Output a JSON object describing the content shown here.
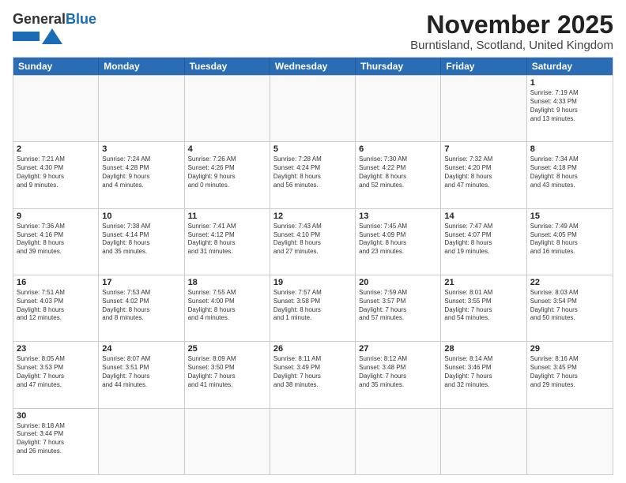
{
  "header": {
    "logo_general": "General",
    "logo_blue": "Blue",
    "title": "November 2025",
    "subtitle": "Burntisland, Scotland, United Kingdom"
  },
  "weekdays": [
    "Sunday",
    "Monday",
    "Tuesday",
    "Wednesday",
    "Thursday",
    "Friday",
    "Saturday"
  ],
  "weeks": [
    {
      "cells": [
        {
          "day": "",
          "info": ""
        },
        {
          "day": "",
          "info": ""
        },
        {
          "day": "",
          "info": ""
        },
        {
          "day": "",
          "info": ""
        },
        {
          "day": "",
          "info": ""
        },
        {
          "day": "",
          "info": ""
        },
        {
          "day": "1",
          "info": "Sunrise: 7:19 AM\nSunset: 4:33 PM\nDaylight: 9 hours\nand 13 minutes."
        }
      ]
    },
    {
      "cells": [
        {
          "day": "2",
          "info": "Sunrise: 7:21 AM\nSunset: 4:30 PM\nDaylight: 9 hours\nand 9 minutes."
        },
        {
          "day": "3",
          "info": "Sunrise: 7:24 AM\nSunset: 4:28 PM\nDaylight: 9 hours\nand 4 minutes."
        },
        {
          "day": "4",
          "info": "Sunrise: 7:26 AM\nSunset: 4:26 PM\nDaylight: 9 hours\nand 0 minutes."
        },
        {
          "day": "5",
          "info": "Sunrise: 7:28 AM\nSunset: 4:24 PM\nDaylight: 8 hours\nand 56 minutes."
        },
        {
          "day": "6",
          "info": "Sunrise: 7:30 AM\nSunset: 4:22 PM\nDaylight: 8 hours\nand 52 minutes."
        },
        {
          "day": "7",
          "info": "Sunrise: 7:32 AM\nSunset: 4:20 PM\nDaylight: 8 hours\nand 47 minutes."
        },
        {
          "day": "8",
          "info": "Sunrise: 7:34 AM\nSunset: 4:18 PM\nDaylight: 8 hours\nand 43 minutes."
        }
      ]
    },
    {
      "cells": [
        {
          "day": "9",
          "info": "Sunrise: 7:36 AM\nSunset: 4:16 PM\nDaylight: 8 hours\nand 39 minutes."
        },
        {
          "day": "10",
          "info": "Sunrise: 7:38 AM\nSunset: 4:14 PM\nDaylight: 8 hours\nand 35 minutes."
        },
        {
          "day": "11",
          "info": "Sunrise: 7:41 AM\nSunset: 4:12 PM\nDaylight: 8 hours\nand 31 minutes."
        },
        {
          "day": "12",
          "info": "Sunrise: 7:43 AM\nSunset: 4:10 PM\nDaylight: 8 hours\nand 27 minutes."
        },
        {
          "day": "13",
          "info": "Sunrise: 7:45 AM\nSunset: 4:09 PM\nDaylight: 8 hours\nand 23 minutes."
        },
        {
          "day": "14",
          "info": "Sunrise: 7:47 AM\nSunset: 4:07 PM\nDaylight: 8 hours\nand 19 minutes."
        },
        {
          "day": "15",
          "info": "Sunrise: 7:49 AM\nSunset: 4:05 PM\nDaylight: 8 hours\nand 16 minutes."
        }
      ]
    },
    {
      "cells": [
        {
          "day": "16",
          "info": "Sunrise: 7:51 AM\nSunset: 4:03 PM\nDaylight: 8 hours\nand 12 minutes."
        },
        {
          "day": "17",
          "info": "Sunrise: 7:53 AM\nSunset: 4:02 PM\nDaylight: 8 hours\nand 8 minutes."
        },
        {
          "day": "18",
          "info": "Sunrise: 7:55 AM\nSunset: 4:00 PM\nDaylight: 8 hours\nand 4 minutes."
        },
        {
          "day": "19",
          "info": "Sunrise: 7:57 AM\nSunset: 3:58 PM\nDaylight: 8 hours\nand 1 minute."
        },
        {
          "day": "20",
          "info": "Sunrise: 7:59 AM\nSunset: 3:57 PM\nDaylight: 7 hours\nand 57 minutes."
        },
        {
          "day": "21",
          "info": "Sunrise: 8:01 AM\nSunset: 3:55 PM\nDaylight: 7 hours\nand 54 minutes."
        },
        {
          "day": "22",
          "info": "Sunrise: 8:03 AM\nSunset: 3:54 PM\nDaylight: 7 hours\nand 50 minutes."
        }
      ]
    },
    {
      "cells": [
        {
          "day": "23",
          "info": "Sunrise: 8:05 AM\nSunset: 3:53 PM\nDaylight: 7 hours\nand 47 minutes."
        },
        {
          "day": "24",
          "info": "Sunrise: 8:07 AM\nSunset: 3:51 PM\nDaylight: 7 hours\nand 44 minutes."
        },
        {
          "day": "25",
          "info": "Sunrise: 8:09 AM\nSunset: 3:50 PM\nDaylight: 7 hours\nand 41 minutes."
        },
        {
          "day": "26",
          "info": "Sunrise: 8:11 AM\nSunset: 3:49 PM\nDaylight: 7 hours\nand 38 minutes."
        },
        {
          "day": "27",
          "info": "Sunrise: 8:12 AM\nSunset: 3:48 PM\nDaylight: 7 hours\nand 35 minutes."
        },
        {
          "day": "28",
          "info": "Sunrise: 8:14 AM\nSunset: 3:46 PM\nDaylight: 7 hours\nand 32 minutes."
        },
        {
          "day": "29",
          "info": "Sunrise: 8:16 AM\nSunset: 3:45 PM\nDaylight: 7 hours\nand 29 minutes."
        }
      ]
    },
    {
      "cells": [
        {
          "day": "30",
          "info": "Sunrise: 8:18 AM\nSunset: 3:44 PM\nDaylight: 7 hours\nand 26 minutes."
        },
        {
          "day": "",
          "info": ""
        },
        {
          "day": "",
          "info": ""
        },
        {
          "day": "",
          "info": ""
        },
        {
          "day": "",
          "info": ""
        },
        {
          "day": "",
          "info": ""
        },
        {
          "day": "",
          "info": ""
        }
      ]
    }
  ]
}
